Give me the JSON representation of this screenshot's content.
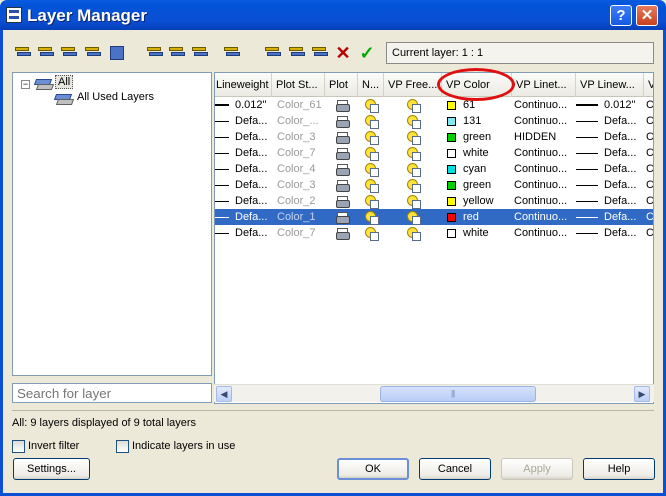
{
  "window": {
    "title": "Layer Manager",
    "help_label": "?",
    "close_label": "✕"
  },
  "toolbar": {
    "current_layer": "Current layer: 1 : 1",
    "delete_icon": "✕",
    "apply_icon": "✓"
  },
  "tree": {
    "expander": "−",
    "root_label": "All",
    "child_label": "All Used Layers"
  },
  "search": {
    "placeholder": "Search for layer"
  },
  "grid": {
    "columns": [
      "Lineweight",
      "Plot St...",
      "Plot",
      "N...",
      "VP Free...",
      "VP Color",
      "VP Linet...",
      "VP Linew...",
      "V"
    ],
    "rows": [
      {
        "lineweight": "0.012\"",
        "lw_thick": true,
        "plot_style": "Color_61",
        "vp_color": "61",
        "vp_color_hex": "#ffff00",
        "vp_linetype": "Continuo...",
        "vp_lineweight": "0.012\"",
        "vp_lw_thick": true,
        "selected": false
      },
      {
        "lineweight": "Defa...",
        "lw_thick": false,
        "plot_style": "Color_...",
        "vp_color": "131",
        "vp_color_hex": "#80e8f0",
        "vp_linetype": "Continuo...",
        "vp_lineweight": "Defa...",
        "vp_lw_thick": false,
        "selected": false
      },
      {
        "lineweight": "Defa...",
        "lw_thick": false,
        "plot_style": "Color_3",
        "vp_color": "green",
        "vp_color_hex": "#00d000",
        "vp_linetype": "HIDDEN",
        "vp_lineweight": "Defa...",
        "vp_lw_thick": false,
        "selected": false
      },
      {
        "lineweight": "Defa...",
        "lw_thick": false,
        "plot_style": "Color_7",
        "vp_color": "white",
        "vp_color_hex": "#ffffff",
        "vp_linetype": "Continuo...",
        "vp_lineweight": "Defa...",
        "vp_lw_thick": false,
        "selected": false
      },
      {
        "lineweight": "Defa...",
        "lw_thick": false,
        "plot_style": "Color_4",
        "vp_color": "cyan",
        "vp_color_hex": "#00e0e0",
        "vp_linetype": "Continuo...",
        "vp_lineweight": "Defa...",
        "vp_lw_thick": false,
        "selected": false
      },
      {
        "lineweight": "Defa...",
        "lw_thick": false,
        "plot_style": "Color_3",
        "vp_color": "green",
        "vp_color_hex": "#00d000",
        "vp_linetype": "Continuo...",
        "vp_lineweight": "Defa...",
        "vp_lw_thick": false,
        "selected": false
      },
      {
        "lineweight": "Defa...",
        "lw_thick": false,
        "plot_style": "Color_2",
        "vp_color": "yellow",
        "vp_color_hex": "#ffff00",
        "vp_linetype": "Continuo...",
        "vp_lineweight": "Defa...",
        "vp_lw_thick": false,
        "selected": false
      },
      {
        "lineweight": "Defa...",
        "lw_thick": false,
        "plot_style": "Color_1",
        "vp_color": "red",
        "vp_color_hex": "#ff0000",
        "vp_linetype": "Continuo...",
        "vp_lineweight": "Defa...",
        "vp_lw_thick": false,
        "selected": true
      },
      {
        "lineweight": "Defa...",
        "lw_thick": false,
        "plot_style": "Color_7",
        "vp_color": "white",
        "vp_color_hex": "#ffffff",
        "vp_linetype": "Continuo...",
        "vp_lineweight": "Defa...",
        "vp_lw_thick": false,
        "selected": false
      }
    ],
    "edge_char": "C"
  },
  "scrollbar": {
    "left": "◀",
    "right": "▶"
  },
  "status": {
    "text": "All: 9 layers displayed of 9 total layers"
  },
  "options": {
    "invert_filter": "Invert filter",
    "indicate_layers": "Indicate layers in use"
  },
  "buttons": {
    "settings": "Settings...",
    "ok": "OK",
    "cancel": "Cancel",
    "apply": "Apply",
    "help": "Help"
  },
  "colors": {
    "titlebar": "#0a4fd4",
    "selection": "#316ac5",
    "highlight_circle": "#e01010"
  }
}
